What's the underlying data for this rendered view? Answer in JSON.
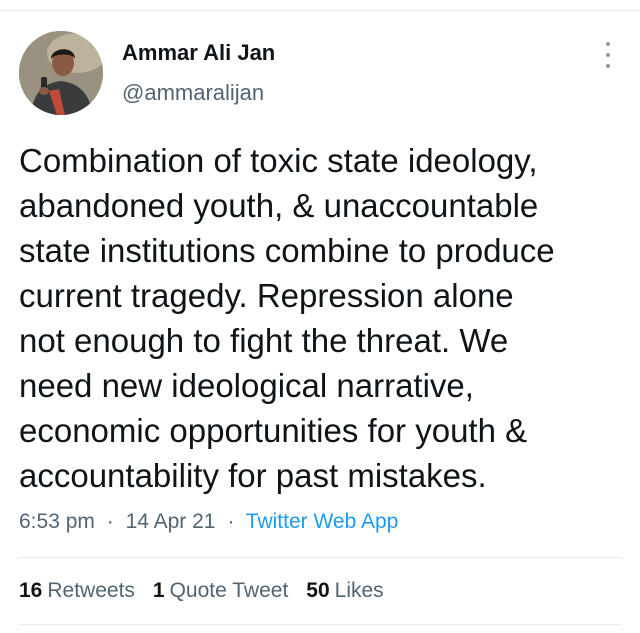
{
  "author": {
    "display_name": "Ammar Ali Jan",
    "handle": "@ammaralijan"
  },
  "tweet": {
    "text": "Combination of toxic state ideology,\nabandoned youth, & unaccountable\nstate institutions combine to produce\ncurrent tragedy. Repression alone\nnot enough to fight the threat. We\nneed new ideological narrative,\neconomic opportunities for youth &\naccountability for past mistakes.",
    "time": "6:53 pm",
    "date": "14 Apr 21",
    "source": "Twitter Web App",
    "separator": "·"
  },
  "stats": {
    "retweets": {
      "count": "16",
      "label": "Retweets"
    },
    "quotes": {
      "count": "1",
      "label": "Quote Tweet"
    },
    "likes": {
      "count": "50",
      "label": "Likes"
    }
  },
  "icons": {
    "more": "more-vertical-icon"
  },
  "colors": {
    "link": "#1d9bf0",
    "secondary_text": "#536471",
    "primary_text": "#0f1419",
    "divider": "#e6ecf0"
  }
}
